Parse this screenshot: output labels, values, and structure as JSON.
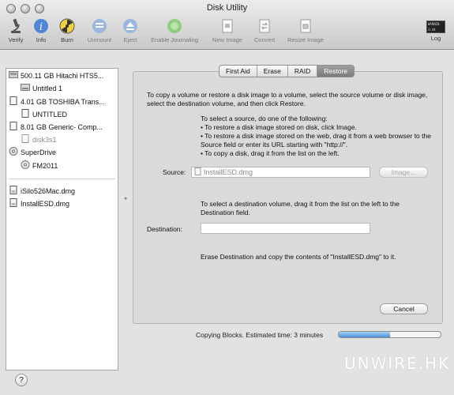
{
  "window": {
    "title": "Disk Utility"
  },
  "toolbar": {
    "verify": "Verify",
    "info": "Info",
    "burn": "Burn",
    "unmount": "Unmount",
    "eject": "Eject",
    "enable_journaling": "Enable Journaling",
    "new_image": "New Image",
    "convert": "Convert",
    "resize_image": "Resize Image",
    "log": "Log",
    "log_badge": "WARNIN 3:44"
  },
  "sidebar": {
    "items": [
      {
        "label": "500.11 GB Hitachi HTS5...",
        "icon": "internal-disk-icon"
      },
      {
        "label": "Untitled 1",
        "icon": "volume-icon"
      },
      {
        "label": "4.01 GB TOSHIBA Trans...",
        "icon": "external-disk-icon"
      },
      {
        "label": "UNTITLED",
        "icon": "volume-icon"
      },
      {
        "label": "8.01 GB Generic- Comp...",
        "icon": "external-disk-icon"
      },
      {
        "label": "disk3s1",
        "icon": "volume-icon"
      },
      {
        "label": "SuperDrive",
        "icon": "optical-drive-icon"
      },
      {
        "label": "FM2011",
        "icon": "optical-disc-icon"
      },
      {
        "label": "iSilo526Mac.dmg",
        "icon": "disk-image-icon"
      },
      {
        "label": "InstallESD.dmg",
        "icon": "disk-image-icon"
      }
    ]
  },
  "tabs": [
    "First Aid",
    "Erase",
    "RAID",
    "Restore"
  ],
  "restore": {
    "intro": "To copy a volume or restore a disk image to a volume, select the source volume or disk image, select the destination volume, and then click Restore.",
    "source_heading": "To select a source, do one of the following:",
    "bullet1": "• To restore a disk image stored on disk, click Image.",
    "bullet2": "• To restore a disk image stored on the web, drag it from a web browser to the Source field or enter its URL starting with \"http://\".",
    "bullet3": "• To copy a disk, drag it from the list on the left.",
    "source_label": "Source:",
    "source_value": "InstallESD.dmg",
    "image_button": "Image...",
    "dest_instructions": "To select a destination volume, drag it from the list on the left to the Destination field.",
    "destination_label": "Destination:",
    "destination_value": "",
    "erase_text": "Erase Destination and copy the contents of \"InstallESD.dmg\" to it.",
    "cancel_button": "Cancel"
  },
  "status": {
    "text": "Copying Blocks. Estimated time: 3 minutes",
    "progress": 0.5
  },
  "help": "?",
  "watermark": "UNWIRE.HK",
  "colors": {
    "progress": "#4a90d9",
    "selected_tab": "#8a8a8a"
  }
}
